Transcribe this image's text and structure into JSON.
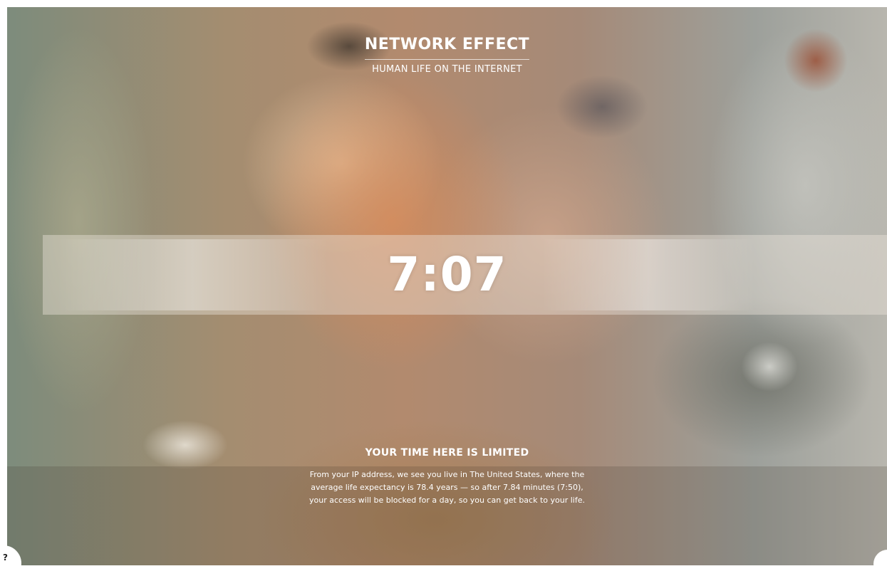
{
  "header": {
    "title": "NETWORK EFFECT",
    "subtitle": "HUMAN LIFE ON THE INTERNET"
  },
  "timer": {
    "value": "7:07"
  },
  "notice": {
    "title": "YOUR TIME HERE IS LIMITED",
    "line1": "From your IP address, we see you live in The United States, where the",
    "line2": "average life expectancy is 78.4 years — so after 7.84 minutes (7:50),",
    "line3": "your access will be blocked for a day, so you can get back to your life."
  },
  "controls": {
    "help_label": "?",
    "help_icon": "question-mark-icon"
  },
  "colors": {
    "text": "#ffffff",
    "band": "#ece4dc"
  }
}
